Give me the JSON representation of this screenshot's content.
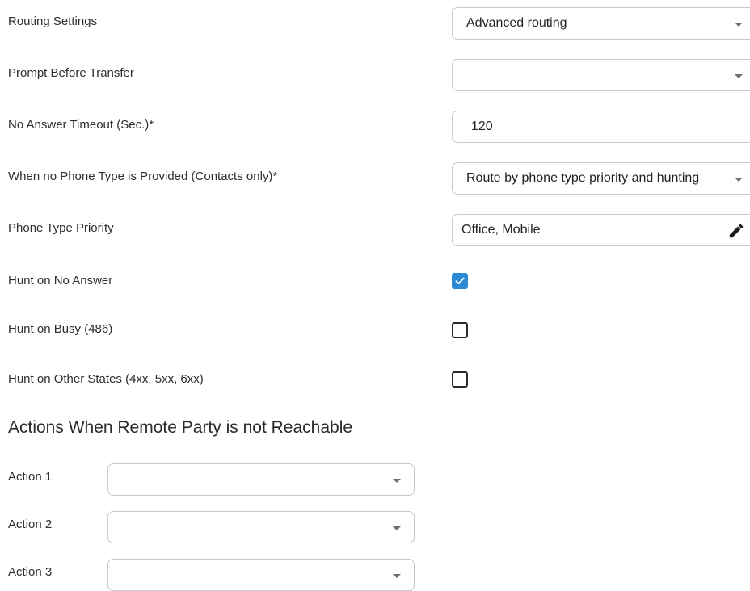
{
  "routing_settings": {
    "label": "Routing Settings",
    "value": "Advanced routing",
    "icon": "chevron-down-icon"
  },
  "prompt_before_transfer": {
    "label": "Prompt Before Transfer",
    "value": "",
    "icon": "chevron-down-icon"
  },
  "no_answer_timeout": {
    "label": "No Answer Timeout (Sec.)*",
    "value": "120"
  },
  "no_phone_type": {
    "label": "When no Phone Type is Provided (Contacts only)*",
    "value": "Route by phone type priority and hunting",
    "icon": "chevron-down-icon"
  },
  "phone_type_priority": {
    "label": "Phone Type Priority",
    "value": "Office, Mobile",
    "icon": "pencil-icon"
  },
  "hunt_on_no_answer": {
    "label": "Hunt on No Answer",
    "checked": true
  },
  "hunt_on_busy": {
    "label": "Hunt on Busy (486)",
    "checked": false
  },
  "hunt_on_other_states": {
    "label": "Hunt on Other States (4xx, 5xx, 6xx)",
    "checked": false
  },
  "actions_section": {
    "title": "Actions When Remote Party is not Reachable",
    "actions": [
      {
        "label": "Action 1",
        "value": ""
      },
      {
        "label": "Action 2",
        "value": ""
      },
      {
        "label": "Action 3",
        "value": ""
      }
    ]
  },
  "colors": {
    "checkbox_checked": "#2b8ad6",
    "border": "#c9c9c9",
    "text": "#2e2e2e"
  }
}
